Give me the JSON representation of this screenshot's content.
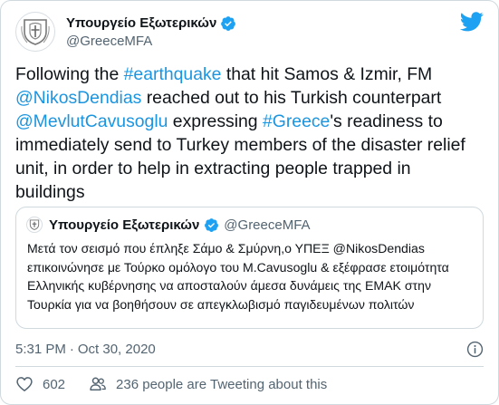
{
  "tweet": {
    "author": {
      "display_name": "Υπουργείο Εξωτερικών",
      "handle": "@GreeceMFA",
      "verified": true,
      "avatar_icon": "greek-coat-of-arms-icon"
    },
    "brand_icon": "twitter-bird-icon",
    "text_segments": [
      {
        "text": "Following the ",
        "type": "text"
      },
      {
        "text": "#earthquake",
        "type": "hashtag"
      },
      {
        "text": " that hit Samos & Izmir, FM ",
        "type": "text"
      },
      {
        "text": "@NikosDendias",
        "type": "mention"
      },
      {
        "text": " reached out to his Turkish counterpart ",
        "type": "text"
      },
      {
        "text": "@MevlutCavusoglu",
        "type": "mention"
      },
      {
        "text": " expressing ",
        "type": "text"
      },
      {
        "text": "#Greece",
        "type": "hashtag"
      },
      {
        "text": "'s readiness to immediately send to Turkey members of the disaster relief unit, in order to help in extracting people trapped in buildings",
        "type": "text"
      }
    ],
    "quoted": {
      "display_name": "Υπουργείο Εξωτερικών",
      "handle": "@GreeceMFA",
      "verified": true,
      "text": "Μετά τον σεισμό που έπληξε Σάμο & Σμύρνη,ο ΥΠΕΞ @NikosDendias επικοινώνησε με Τούρκο ομόλογο του M.Cavusoglu & εξέφρασε ετοιμότητα Ελληνικής κυβέρνησης να αποσταλούν άμεσα δυνάμεις της ΕΜΑΚ στην Τουρκία για να βοηθήσουν σε απεγκλωβισμό παγιδευμένων πολιτών"
    },
    "timestamp": {
      "time": "5:31 PM",
      "separator": "·",
      "date": "Oct 30, 2020"
    },
    "actions": {
      "likes_count": "602",
      "tweeting_label": "236 people are Tweeting about this"
    },
    "colors": {
      "link": "#1b95e0",
      "twitter_blue": "#1da1f2",
      "text": "#0f1419",
      "secondary": "#536471",
      "border": "#cfd9de"
    }
  }
}
